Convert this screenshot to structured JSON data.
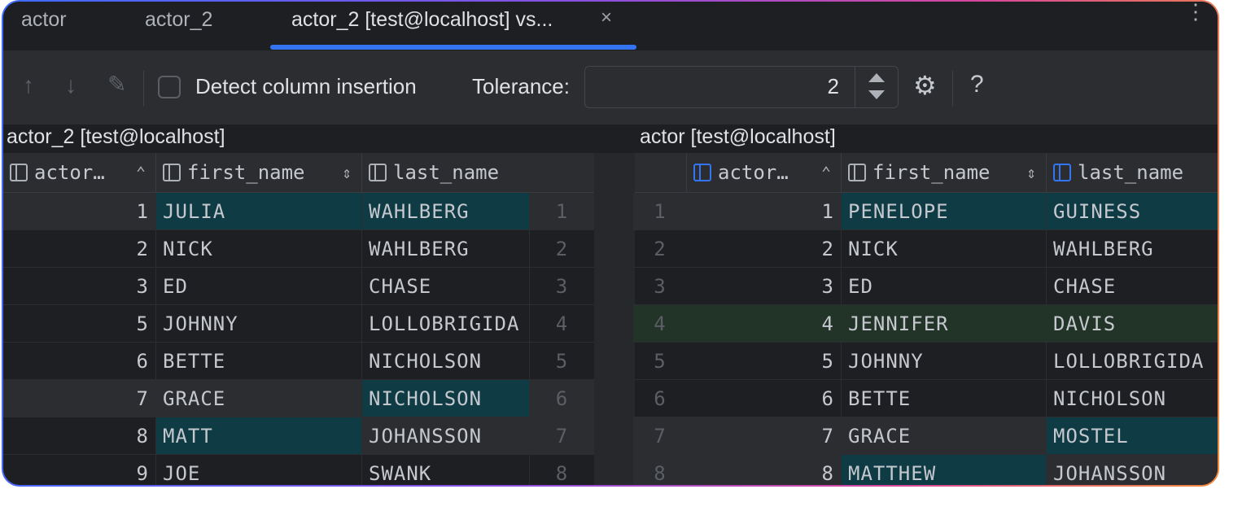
{
  "tabs": [
    {
      "label": "actor"
    },
    {
      "label": "actor_2"
    },
    {
      "label": "actor_2 [test@localhost] vs..."
    }
  ],
  "tab_close_glyph": "×",
  "more_glyph": "⋮",
  "toolbar": {
    "prev_icon": "↑",
    "next_icon": "↓",
    "edit_icon": "✎",
    "detect_label": "Detect column insertion",
    "detect_checked": false,
    "tolerance_label": "Tolerance:",
    "tolerance_value": "2",
    "settings_icon": "⚙",
    "help_icon": "?"
  },
  "left": {
    "title": "actor_2 [test@localhost]",
    "columns": [
      "actor…",
      "first_name",
      "last_name"
    ],
    "rows": [
      {
        "id": "1",
        "first": "JULIA",
        "last": "WAHLBERG",
        "gutter": "1"
      },
      {
        "id": "2",
        "first": "NICK",
        "last": "WAHLBERG",
        "gutter": "2"
      },
      {
        "id": "3",
        "first": "ED",
        "last": "CHASE",
        "gutter": "3"
      },
      {
        "id": "5",
        "first": "JOHNNY",
        "last": "LOLLOBRIGIDA",
        "gutter": "4"
      },
      {
        "id": "6",
        "first": "BETTE",
        "last": "NICHOLSON",
        "gutter": "5"
      },
      {
        "id": "7",
        "first": "GRACE",
        "last": "NICHOLSON",
        "gutter": "6"
      },
      {
        "id": "8",
        "first": "MATT",
        "last": "JOHANSSON",
        "gutter": "7"
      },
      {
        "id": "9",
        "first": "JOE",
        "last": "SWANK",
        "gutter": "8"
      }
    ]
  },
  "right": {
    "title": "actor [test@localhost]",
    "columns": [
      "actor…",
      "first_name",
      "last_name"
    ],
    "rows": [
      {
        "gutter": "1",
        "id": "1",
        "first": "PENELOPE",
        "last": "GUINESS"
      },
      {
        "gutter": "2",
        "id": "2",
        "first": "NICK",
        "last": "WAHLBERG"
      },
      {
        "gutter": "3",
        "id": "3",
        "first": "ED",
        "last": "CHASE"
      },
      {
        "gutter": "4",
        "id": "4",
        "first": "JENNIFER",
        "last": "DAVIS"
      },
      {
        "gutter": "5",
        "id": "5",
        "first": "JOHNNY",
        "last": "LOLLOBRIGIDA"
      },
      {
        "gutter": "6",
        "id": "6",
        "first": "BETTE",
        "last": "NICHOLSON"
      },
      {
        "gutter": "7",
        "id": "7",
        "first": "GRACE",
        "last": "MOSTEL"
      },
      {
        "gutter": "8",
        "id": "8",
        "first": "MATTHEW",
        "last": "JOHANSSON"
      }
    ]
  },
  "colors": {
    "accent": "#3574f0",
    "modified": "#0f3b44",
    "inserted": "#213427",
    "background": "#1e1f22"
  }
}
